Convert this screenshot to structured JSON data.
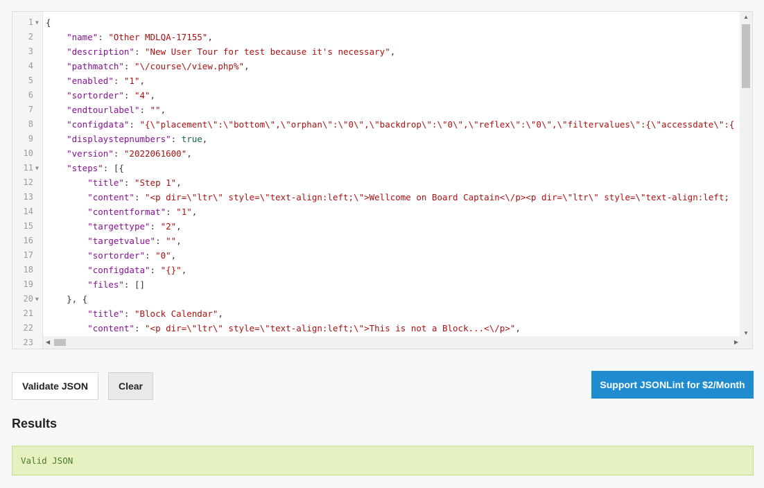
{
  "editor": {
    "lines": [
      {
        "n": "1",
        "fold": true,
        "html": "{"
      },
      {
        "n": "2",
        "html": "    <span class='k'>\"name\"</span>: <span class='s'>\"Other MDLQA-17155\"</span>,"
      },
      {
        "n": "3",
        "html": "    <span class='k'>\"description\"</span>: <span class='s'>\"New User Tour for test because it's necessary\"</span>,"
      },
      {
        "n": "4",
        "html": "    <span class='k'>\"pathmatch\"</span>: <span class='s'>\"\\/course\\/view.php%\"</span>,"
      },
      {
        "n": "5",
        "html": "    <span class='k'>\"enabled\"</span>: <span class='s'>\"1\"</span>,"
      },
      {
        "n": "6",
        "html": "    <span class='k'>\"sortorder\"</span>: <span class='s'>\"4\"</span>,"
      },
      {
        "n": "7",
        "html": "    <span class='k'>\"endtourlabel\"</span>: <span class='s'>\"\"</span>,"
      },
      {
        "n": "8",
        "html": "    <span class='k'>\"configdata\"</span>: <span class='s'>\"{\\\"placement\\\":\\\"bottom\\\",\\\"orphan\\\":\\\"0\\\",\\\"backdrop\\\":\\\"0\\\",\\\"reflex\\\":\\\"0\\\",\\\"filtervalues\\\":{\\\"accessdate\\\":{</span>"
      },
      {
        "n": "9",
        "html": "    <span class='k'>\"displaystepnumbers\"</span>: <span class='b'>true</span>,"
      },
      {
        "n": "10",
        "html": "    <span class='k'>\"version\"</span>: <span class='s'>\"2022061600\"</span>,"
      },
      {
        "n": "11",
        "fold": true,
        "html": "    <span class='k'>\"steps\"</span>: [{"
      },
      {
        "n": "12",
        "html": "        <span class='k'>\"title\"</span>: <span class='s'>\"Step 1\"</span>,"
      },
      {
        "n": "13",
        "html": "        <span class='k'>\"content\"</span>: <span class='s'>\"&lt;p dir=\\\"ltr\\\" style=\\\"text-align:left;\\\"&gt;Wellcome on Board Captain&lt;\\/p&gt;&lt;p dir=\\\"ltr\\\" style=\\\"text-align:left;</span>"
      },
      {
        "n": "14",
        "html": "        <span class='k'>\"contentformat\"</span>: <span class='s'>\"1\"</span>,"
      },
      {
        "n": "15",
        "html": "        <span class='k'>\"targettype\"</span>: <span class='s'>\"2\"</span>,"
      },
      {
        "n": "16",
        "html": "        <span class='k'>\"targetvalue\"</span>: <span class='s'>\"\"</span>,"
      },
      {
        "n": "17",
        "html": "        <span class='k'>\"sortorder\"</span>: <span class='s'>\"0\"</span>,"
      },
      {
        "n": "18",
        "html": "        <span class='k'>\"configdata\"</span>: <span class='s'>\"{}\"</span>,"
      },
      {
        "n": "19",
        "html": "        <span class='k'>\"files\"</span>: []"
      },
      {
        "n": "20",
        "fold": true,
        "html": "    }, {"
      },
      {
        "n": "21",
        "html": "        <span class='k'>\"title\"</span>: <span class='s'>\"Block Calendar\"</span>,"
      },
      {
        "n": "22",
        "html": "        <span class='k'>\"content\"</span>: <span class='s'>\"&lt;p dir=\\\"ltr\\\" style=\\\"text-align:left;\\\"&gt;This is not a Block...&lt;\\/p&gt;\"</span>,"
      },
      {
        "n": "23",
        "html": ""
      }
    ]
  },
  "buttons": {
    "validate": "Validate JSON",
    "clear": "Clear",
    "support": "Support JSONLint for $2/Month"
  },
  "results": {
    "title": "Results",
    "message": "Valid JSON"
  },
  "colors": {
    "accent": "#1f8ccf",
    "success_bg": "#e5f1c1"
  }
}
